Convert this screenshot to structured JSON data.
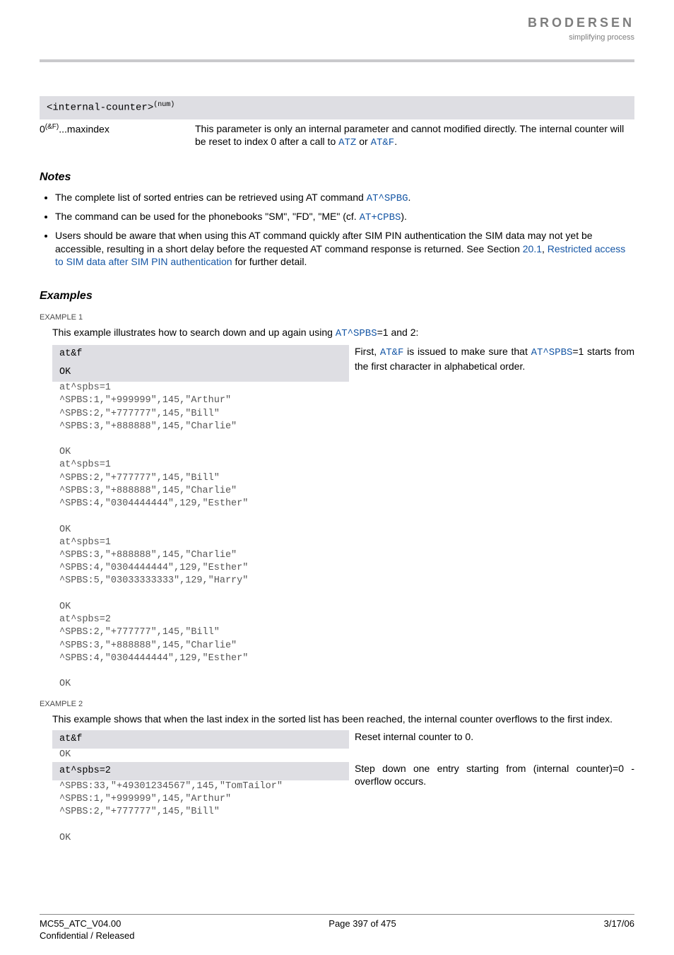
{
  "logo": {
    "name": "BRODERSEN",
    "tagline": "simplifying process"
  },
  "param": {
    "name": "<internal-counter>",
    "super": "(num)",
    "value": "0",
    "value_super": "(&F)",
    "value_rest": "...maxindex",
    "desc_pre": "This parameter is only an internal parameter and cannot modified directly. The internal counter will be reset to index 0 after a call to ",
    "link1": "ATZ",
    "mid": " or ",
    "link2": "AT&F",
    "end": "."
  },
  "notes_header": "Notes",
  "notes": {
    "n1_pre": "The complete list of sorted entries can be retrieved using AT command ",
    "n1_link": "AT^SPBG",
    "n1_end": ".",
    "n2_pre": "The command can be used for the phonebooks \"SM\", \"FD\", \"ME\" (cf. ",
    "n2_link": "AT+CPBS",
    "n2_end": ").",
    "n3_line1": "Users should be aware that when using this AT command quickly after SIM PIN authentication the SIM data may not yet be accessible, resulting in a short delay before the requested AT command response is returned. See Section ",
    "n3_link1": "20.1",
    "n3_mid": ", ",
    "n3_link2": "Restricted access to SIM data after SIM PIN authentication",
    "n3_end": " for further detail."
  },
  "examples_header": "Examples",
  "ex1": {
    "label": "EXAMPLE 1",
    "intro_pre": "This example illustrates how to search down and up again using ",
    "intro_link": "AT^SPBS",
    "intro_post": "=1 and 2:",
    "cmd1": "at&f",
    "resp1": "OK",
    "cmt_pre": "First, ",
    "cmt_l1": "AT&F",
    "cmt_mid": " is issued to make sure that ",
    "cmt_l2": "AT^SPBS",
    "cmt_post": "=1 starts from the first character in alphabetical order.",
    "block1": "at^spbs=1\n^SPBS:1,\"+999999\",145,\"Arthur\"\n^SPBS:2,\"+777777\",145,\"Bill\"\n^SPBS:3,\"+888888\",145,\"Charlie\"\n\nOK\nat^spbs=1\n^SPBS:2,\"+777777\",145,\"Bill\"\n^SPBS:3,\"+888888\",145,\"Charlie\"\n^SPBS:4,\"0304444444\",129,\"Esther\"\n\nOK\nat^spbs=1\n^SPBS:3,\"+888888\",145,\"Charlie\"\n^SPBS:4,\"0304444444\",129,\"Esther\"\n^SPBS:5,\"03033333333\",129,\"Harry\"\n\nOK\nat^spbs=2\n^SPBS:2,\"+777777\",145,\"Bill\"\n^SPBS:3,\"+888888\",145,\"Charlie\"\n^SPBS:4,\"0304444444\",129,\"Esther\"\n\nOK"
  },
  "ex2": {
    "label": "EXAMPLE 2",
    "intro": "This example shows that when the last index in the sorted list has been reached, the internal counter overflows to the first index.",
    "cmd1": "at&f",
    "resp1": "OK",
    "cmt1": "Reset internal counter to 0.",
    "cmd2": "at^spbs=2",
    "block2": "^SPBS:33,\"+49301234567\",145,\"TomTailor\"\n^SPBS:1,\"+999999\",145,\"Arthur\"\n^SPBS:2,\"+777777\",145,\"Bill\"\n\nOK",
    "cmt2": "Step down one entry starting from (internal counter)=0 - overflow occurs."
  },
  "footer": {
    "left1": "MC55_ATC_V04.00",
    "left2": "Confidential / Released",
    "center": "Page 397 of 475",
    "right": "3/17/06"
  }
}
